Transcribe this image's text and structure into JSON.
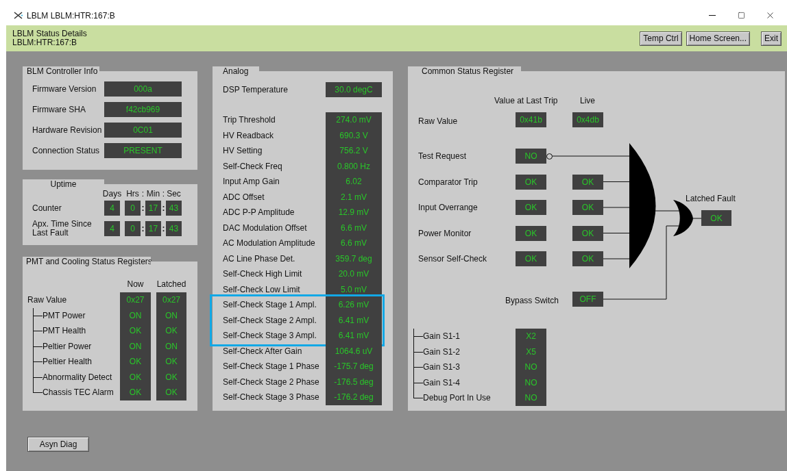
{
  "window": {
    "title": "LBLM LBLM:HTR:167:B"
  },
  "header": {
    "title": "LBLM Status Details",
    "subtitle": "LBLM:HTR:167:B",
    "buttons": [
      "Temp Ctrl",
      "Home Screen...",
      "Exit"
    ]
  },
  "controller_info": {
    "title": "BLM Controller Info",
    "rows": [
      {
        "label": "Firmware Version",
        "value": "000a"
      },
      {
        "label": "Firmware SHA",
        "value": "f42cb969"
      },
      {
        "label": "Hardware Revision",
        "value": "0C01"
      },
      {
        "label": "Connection Status",
        "value": "PRESENT"
      }
    ]
  },
  "uptime": {
    "title": "Uptime",
    "headers": [
      "Days",
      "Hrs",
      ":",
      "Min",
      ":",
      "Sec"
    ],
    "rows": [
      {
        "label": "Counter",
        "values": [
          {
            "kind": "box",
            "text": "4"
          },
          {
            "kind": "box",
            "text": "0"
          },
          {
            "kind": "sep",
            "text": ":"
          },
          {
            "kind": "box",
            "text": "17"
          },
          {
            "kind": "sep",
            "text": ":"
          },
          {
            "kind": "box",
            "text": "43"
          }
        ]
      },
      {
        "label": "Apx. Time Since Last Fault",
        "values": [
          {
            "kind": "box",
            "text": "4"
          },
          {
            "kind": "box",
            "text": "0"
          },
          {
            "kind": "sep",
            "text": ":"
          },
          {
            "kind": "box",
            "text": "17"
          },
          {
            "kind": "sep",
            "text": ":"
          },
          {
            "kind": "box",
            "text": "43"
          }
        ]
      }
    ]
  },
  "pmt_cooling": {
    "title": "PMT and Cooling Status Registers",
    "columns": [
      "Now",
      "Latched"
    ],
    "rows": [
      {
        "label": "Raw Value",
        "now": "0x27",
        "latched": "0x27",
        "children": [
          {
            "label": "PMT Power",
            "now": "ON",
            "latched": "ON"
          },
          {
            "label": "PMT Health",
            "now": "OK",
            "latched": "OK"
          },
          {
            "label": "Peltier Power",
            "now": "ON",
            "latched": "ON"
          },
          {
            "label": "Peltier Health",
            "now": "OK",
            "latched": "OK"
          },
          {
            "label": "Abnormality Detect",
            "now": "OK",
            "latched": "OK"
          },
          {
            "label": "Chassis TEC Alarm",
            "now": "OK",
            "latched": "OK"
          }
        ]
      }
    ]
  },
  "analog": {
    "title": "Analog",
    "dsp": {
      "label": "DSP Temperature",
      "value": "30.0 degC"
    },
    "rows": [
      {
        "label": "Trip Threshold",
        "value": "274.0 mV",
        "highlighted": false
      },
      {
        "label": "HV Readback",
        "value": "690.3 V",
        "highlighted": false
      },
      {
        "label": "HV Setting",
        "value": "756.2 V",
        "highlighted": false
      },
      {
        "label": "Self-Check Freq",
        "value": "0.800 Hz",
        "highlighted": false
      },
      {
        "label": "Input Amp Gain",
        "value": "6.02",
        "highlighted": false
      },
      {
        "label": "ADC Offset",
        "value": "2.1 mV",
        "highlighted": false
      },
      {
        "label": "ADC P-P Amplitude",
        "value": "12.9 mV",
        "highlighted": false
      },
      {
        "label": "DAC Modulation Offset",
        "value": "6.6 mV",
        "highlighted": false
      },
      {
        "label": "AC Modulation Amplitude",
        "value": "6.6 mV",
        "highlighted": false
      },
      {
        "label": "AC Line Phase Det.",
        "value": "359.7 deg",
        "highlighted": false
      },
      {
        "label": "Self-Check High Limit",
        "value": "20.0 mV",
        "highlighted": false
      },
      {
        "label": "Self-Check Low Limit",
        "value": "5.0 mV",
        "highlighted": false
      },
      {
        "label": "Self-Check Stage 1 Ampl.",
        "value": "6.26 mV",
        "highlighted": true
      },
      {
        "label": "Self-Check Stage 2 Ampl.",
        "value": "6.41 mV",
        "highlighted": true
      },
      {
        "label": "Self-Check Stage 3 Ampl.",
        "value": "6.41 mV",
        "highlighted": true
      },
      {
        "label": "Self-Check After Gain",
        "value": "1064.6 uV",
        "highlighted": false
      },
      {
        "label": "Self-Check Stage 1 Phase",
        "value": "-175.7 deg",
        "highlighted": false
      },
      {
        "label": "Self-Check Stage 2 Phase",
        "value": "-176.5 deg",
        "highlighted": false
      },
      {
        "label": "Self-Check Stage 3 Phase",
        "value": "-176.2 deg",
        "highlighted": false
      }
    ]
  },
  "common_status": {
    "title": "Common Status Register",
    "columns": [
      "Value at Last Trip",
      "Live"
    ],
    "raw": {
      "label": "Raw Value",
      "last_trip": "0x41b",
      "live": "0x4db"
    },
    "inputs": [
      {
        "label": "Test Request",
        "last_trip": "NO",
        "inverted": true
      },
      {
        "label": "Comparator Trip",
        "last_trip": "OK",
        "live": "OK",
        "inverted": false
      },
      {
        "label": "Input Overrange",
        "last_trip": "OK",
        "live": "OK",
        "inverted": false
      },
      {
        "label": "Power Monitor",
        "last_trip": "OK",
        "live": "OK",
        "inverted": false
      },
      {
        "label": "Sensor Self-Check",
        "last_trip": "OK",
        "live": "OK",
        "inverted": false
      }
    ],
    "output": {
      "label": "Latched Fault",
      "value": "OK"
    },
    "bypass": {
      "label": "Bypass Switch",
      "value": "OFF"
    },
    "bits": [
      {
        "label": "Gain S1-1",
        "value": "X2"
      },
      {
        "label": "Gain S1-2",
        "value": "X5"
      },
      {
        "label": "Gain S1-3",
        "value": "NO"
      },
      {
        "label": "Gain S1-4",
        "value": "NO"
      },
      {
        "label": "Debug Port In Use",
        "value": "NO"
      }
    ]
  },
  "footer_buttons": [
    "Asyn Diag"
  ]
}
